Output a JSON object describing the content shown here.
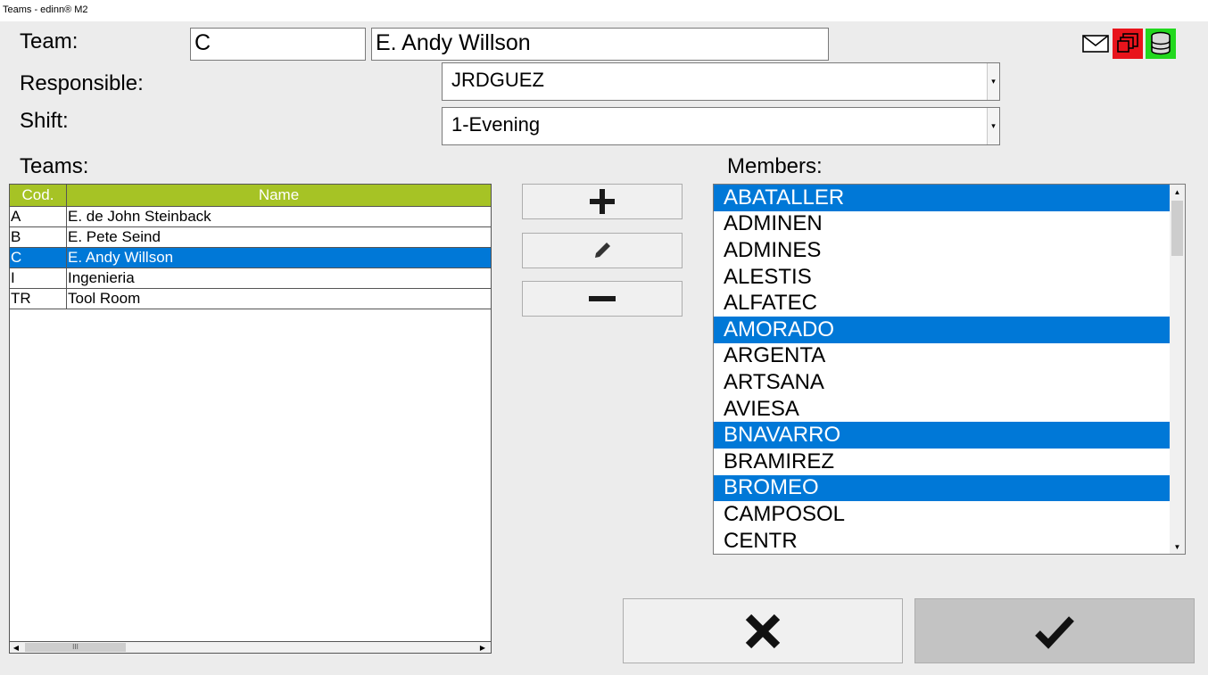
{
  "window": {
    "title": "Teams - edinn® M2"
  },
  "labels": {
    "team": "Team:",
    "responsible": "Responsible:",
    "shift": "Shift:",
    "teams": "Teams:",
    "members": "Members:"
  },
  "team_code": "C",
  "team_name": "E. Andy Willson",
  "responsible": {
    "value": "JRDGUEZ"
  },
  "shift": {
    "value": "1-Evening"
  },
  "icons": {
    "mail": "mail-icon",
    "windows": "windows-icon",
    "database": "database-icon"
  },
  "colors": {
    "header_green": "#a6c325",
    "selection_blue": "#0078d7",
    "icon_red": "#e8141c",
    "icon_green": "#22d81e"
  },
  "teams_grid": {
    "headers": {
      "code": "Cod.",
      "name": "Name"
    },
    "rows": [
      {
        "code": "A",
        "name": "E. de John Steinback",
        "selected": false
      },
      {
        "code": "B",
        "name": "E. Pete Seind",
        "selected": false
      },
      {
        "code": "C",
        "name": "E. Andy Willson",
        "selected": true
      },
      {
        "code": "I",
        "name": "Ingenieria",
        "selected": false
      },
      {
        "code": "TR",
        "name": "Tool Room",
        "selected": false
      }
    ]
  },
  "members": [
    {
      "name": "ABATALLER",
      "selected": true
    },
    {
      "name": "ADMINEN",
      "selected": false
    },
    {
      "name": "ADMINES",
      "selected": false
    },
    {
      "name": "ALESTIS",
      "selected": false
    },
    {
      "name": "ALFATEC",
      "selected": false
    },
    {
      "name": "AMORADO",
      "selected": true
    },
    {
      "name": "ARGENTA",
      "selected": false
    },
    {
      "name": "ARTSANA",
      "selected": false
    },
    {
      "name": "AVIESA",
      "selected": false
    },
    {
      "name": "BNAVARRO",
      "selected": true
    },
    {
      "name": "BRAMIREZ",
      "selected": false
    },
    {
      "name": "BROMEO",
      "selected": true
    },
    {
      "name": "CAMPOSOL",
      "selected": false
    },
    {
      "name": "CENTR",
      "selected": false
    }
  ]
}
